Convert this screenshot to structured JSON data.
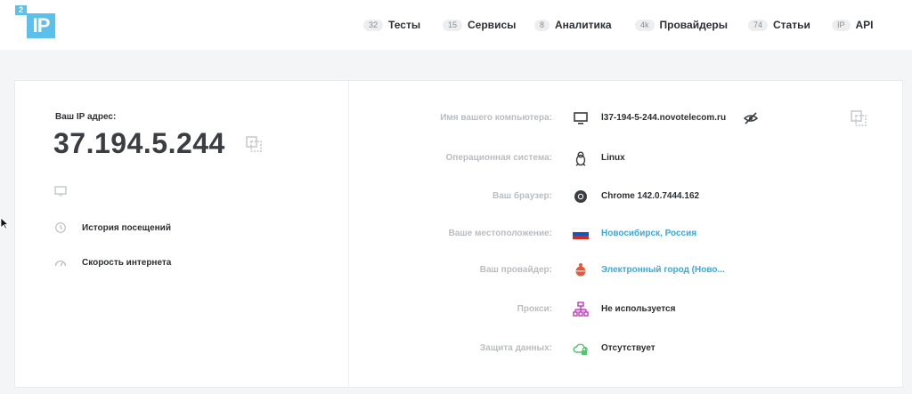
{
  "logo": {
    "sup": "2",
    "main": "IP"
  },
  "nav": [
    {
      "badge": "32",
      "label": "Тесты"
    },
    {
      "badge": "15",
      "label": "Сервисы"
    },
    {
      "badge": "8",
      "label": "Аналитика"
    },
    {
      "badge": "4k",
      "label": "Провайдеры"
    },
    {
      "badge": "74",
      "label": "Статьи"
    },
    {
      "badge": "IP",
      "label": "API"
    }
  ],
  "left": {
    "ip_label": "Ваш IP адрес:",
    "ip_value": "37.194.5.244",
    "links": [
      {
        "label": "История посещений",
        "icon": "history-icon"
      },
      {
        "label": "Скорость интернета",
        "icon": "speedometer-icon"
      }
    ]
  },
  "info": [
    {
      "key": "Имя вашего компьютера:",
      "value": "l37-194-5-244.novotelecom.ru",
      "icon": "monitor-icon",
      "link": false
    },
    {
      "key": "Операционная система:",
      "value": "Linux",
      "icon": "linux-icon",
      "link": false
    },
    {
      "key": "Ваш браузер:",
      "value": "Chrome 142.0.7444.162",
      "icon": "chrome-icon",
      "link": false
    },
    {
      "key": "Ваше местоположение:",
      "value": "Новосибирск, Россия",
      "icon": "russia-flag-icon",
      "link": true
    },
    {
      "key": "Ваш провайдер:",
      "value": "Электронный город (Ново...",
      "icon": "provider-icon",
      "link": true
    },
    {
      "key": "Прокси:",
      "value": "Не используется",
      "icon": "proxy-icon",
      "link": false
    },
    {
      "key": "Защита данных:",
      "value": "Отсутствует",
      "icon": "cloud-lock-icon",
      "link": false
    }
  ],
  "colors": {
    "brand": "#5bc0ea",
    "link": "#39a9dc",
    "proxy": "#c13bbd",
    "cloud": "#4cc76b",
    "provider": "#e7553a"
  }
}
